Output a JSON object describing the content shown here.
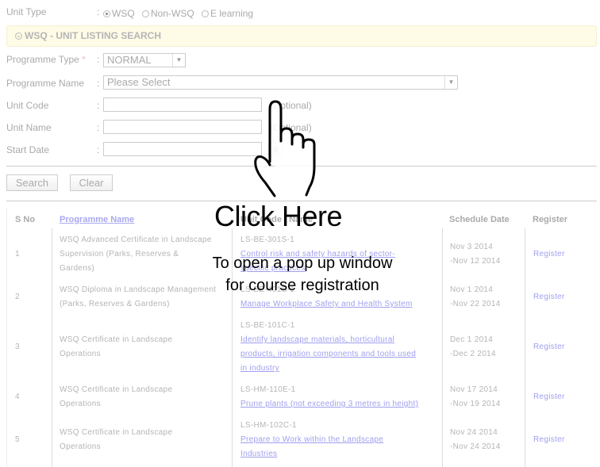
{
  "unit_type": {
    "label": "Unit Type",
    "colon": ":",
    "options": [
      {
        "label": "WSQ",
        "selected": true
      },
      {
        "label": "Non-WSQ",
        "selected": false
      },
      {
        "label": "E learning",
        "selected": false
      }
    ]
  },
  "section_title": "WSQ - UNIT LISTING SEARCH",
  "form": {
    "programme_type": {
      "label": "Programme Type",
      "required_mark": "*",
      "colon": ":",
      "value": "NORMAL"
    },
    "programme_name": {
      "label": "Programme Name",
      "colon": ":",
      "value": "Please Select"
    },
    "unit_code": {
      "label": "Unit Code",
      "colon": ":",
      "value": "",
      "hint": "(Optional)"
    },
    "unit_name": {
      "label": "Unit Name",
      "colon": ":",
      "value": "",
      "hint": "(Optional)"
    },
    "start_date": {
      "label": "Start Date",
      "colon": ":",
      "value": ""
    }
  },
  "buttons": {
    "search": "Search",
    "clear": "Clear"
  },
  "table": {
    "headers": {
      "sno": "S No",
      "programme_name": "Programme Name",
      "unit": "Unit Code / Name",
      "schedule_date": "Schedule Date",
      "register": "Register"
    },
    "rows": [
      {
        "sno": "1",
        "programme": [
          "WSQ Advanced Certificate in Landscape",
          "Supervision (Parks, Reserves &",
          "Gardens)"
        ],
        "code": "LS-BE-301S-1",
        "unit_name": [
          "Control risk and safety hazards of sector-",
          "specific practices"
        ],
        "date_from": "Nov 3 2014",
        "date_to": "-Nov 12 2014",
        "register": "Register"
      },
      {
        "sno": "2",
        "programme": [
          "WSQ Diploma in Landscape Management",
          "(Parks, Reserves & Gardens)"
        ],
        "code": "LS-BE-401S-1",
        "unit_name": [
          "Manage Workplace Safety and Health System"
        ],
        "date_from": "Nov 1 2014",
        "date_to": "-Nov 22 2014",
        "register": "Register"
      },
      {
        "sno": "3",
        "programme": [
          "WSQ Certificate in Landscape",
          "Operations"
        ],
        "code": "LS-BE-101C-1",
        "unit_name": [
          "Identify landscape materials, horticultural",
          "products, irrigation components and tools used",
          "in industry"
        ],
        "date_from": "Dec 1 2014",
        "date_to": "-Dec 2 2014",
        "register": "Register"
      },
      {
        "sno": "4",
        "programme": [
          "WSQ Certificate in Landscape",
          "Operations"
        ],
        "code": "LS-HM-110E-1",
        "unit_name": [
          "Prune plants (not exceeding 3 metres in height)"
        ],
        "date_from": "Nov 17 2014",
        "date_to": "-Nov 19 2014",
        "register": "Register"
      },
      {
        "sno": "5",
        "programme": [
          "WSQ Certificate in Landscape",
          "Operations"
        ],
        "code": "LS-HM-102C-1",
        "unit_name": [
          "Prepare to Work within the Landscape",
          "Industries"
        ],
        "date_from": "Nov 24 2014",
        "date_to": "-Nov 24 2014",
        "register": "Register"
      }
    ]
  },
  "overlay": {
    "icon": "pointing-hand-icon",
    "title": "Click Here",
    "subtitle_lines": [
      "To open a pop up window",
      "for course registration"
    ]
  }
}
